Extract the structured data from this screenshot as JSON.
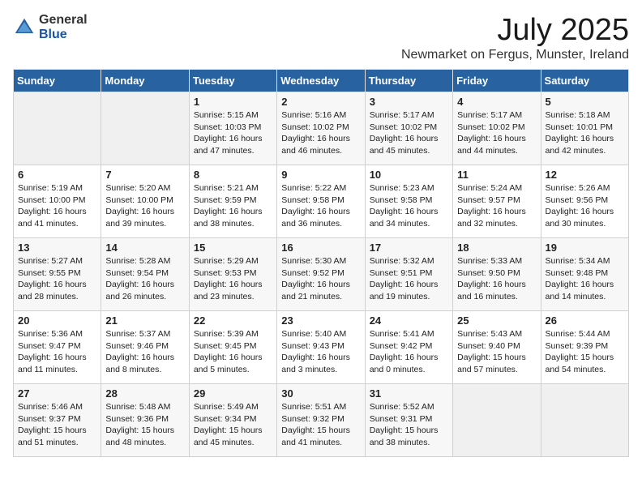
{
  "logo": {
    "general": "General",
    "blue": "Blue"
  },
  "title": "July 2025",
  "location": "Newmarket on Fergus, Munster, Ireland",
  "days_of_week": [
    "Sunday",
    "Monday",
    "Tuesday",
    "Wednesday",
    "Thursday",
    "Friday",
    "Saturday"
  ],
  "weeks": [
    [
      {
        "day": "",
        "content": ""
      },
      {
        "day": "",
        "content": ""
      },
      {
        "day": "1",
        "content": "Sunrise: 5:15 AM\nSunset: 10:03 PM\nDaylight: 16 hours\nand 47 minutes."
      },
      {
        "day": "2",
        "content": "Sunrise: 5:16 AM\nSunset: 10:02 PM\nDaylight: 16 hours\nand 46 minutes."
      },
      {
        "day": "3",
        "content": "Sunrise: 5:17 AM\nSunset: 10:02 PM\nDaylight: 16 hours\nand 45 minutes."
      },
      {
        "day": "4",
        "content": "Sunrise: 5:17 AM\nSunset: 10:02 PM\nDaylight: 16 hours\nand 44 minutes."
      },
      {
        "day": "5",
        "content": "Sunrise: 5:18 AM\nSunset: 10:01 PM\nDaylight: 16 hours\nand 42 minutes."
      }
    ],
    [
      {
        "day": "6",
        "content": "Sunrise: 5:19 AM\nSunset: 10:00 PM\nDaylight: 16 hours\nand 41 minutes."
      },
      {
        "day": "7",
        "content": "Sunrise: 5:20 AM\nSunset: 10:00 PM\nDaylight: 16 hours\nand 39 minutes."
      },
      {
        "day": "8",
        "content": "Sunrise: 5:21 AM\nSunset: 9:59 PM\nDaylight: 16 hours\nand 38 minutes."
      },
      {
        "day": "9",
        "content": "Sunrise: 5:22 AM\nSunset: 9:58 PM\nDaylight: 16 hours\nand 36 minutes."
      },
      {
        "day": "10",
        "content": "Sunrise: 5:23 AM\nSunset: 9:58 PM\nDaylight: 16 hours\nand 34 minutes."
      },
      {
        "day": "11",
        "content": "Sunrise: 5:24 AM\nSunset: 9:57 PM\nDaylight: 16 hours\nand 32 minutes."
      },
      {
        "day": "12",
        "content": "Sunrise: 5:26 AM\nSunset: 9:56 PM\nDaylight: 16 hours\nand 30 minutes."
      }
    ],
    [
      {
        "day": "13",
        "content": "Sunrise: 5:27 AM\nSunset: 9:55 PM\nDaylight: 16 hours\nand 28 minutes."
      },
      {
        "day": "14",
        "content": "Sunrise: 5:28 AM\nSunset: 9:54 PM\nDaylight: 16 hours\nand 26 minutes."
      },
      {
        "day": "15",
        "content": "Sunrise: 5:29 AM\nSunset: 9:53 PM\nDaylight: 16 hours\nand 23 minutes."
      },
      {
        "day": "16",
        "content": "Sunrise: 5:30 AM\nSunset: 9:52 PM\nDaylight: 16 hours\nand 21 minutes."
      },
      {
        "day": "17",
        "content": "Sunrise: 5:32 AM\nSunset: 9:51 PM\nDaylight: 16 hours\nand 19 minutes."
      },
      {
        "day": "18",
        "content": "Sunrise: 5:33 AM\nSunset: 9:50 PM\nDaylight: 16 hours\nand 16 minutes."
      },
      {
        "day": "19",
        "content": "Sunrise: 5:34 AM\nSunset: 9:48 PM\nDaylight: 16 hours\nand 14 minutes."
      }
    ],
    [
      {
        "day": "20",
        "content": "Sunrise: 5:36 AM\nSunset: 9:47 PM\nDaylight: 16 hours\nand 11 minutes."
      },
      {
        "day": "21",
        "content": "Sunrise: 5:37 AM\nSunset: 9:46 PM\nDaylight: 16 hours\nand 8 minutes."
      },
      {
        "day": "22",
        "content": "Sunrise: 5:39 AM\nSunset: 9:45 PM\nDaylight: 16 hours\nand 5 minutes."
      },
      {
        "day": "23",
        "content": "Sunrise: 5:40 AM\nSunset: 9:43 PM\nDaylight: 16 hours\nand 3 minutes."
      },
      {
        "day": "24",
        "content": "Sunrise: 5:41 AM\nSunset: 9:42 PM\nDaylight: 16 hours\nand 0 minutes."
      },
      {
        "day": "25",
        "content": "Sunrise: 5:43 AM\nSunset: 9:40 PM\nDaylight: 15 hours\nand 57 minutes."
      },
      {
        "day": "26",
        "content": "Sunrise: 5:44 AM\nSunset: 9:39 PM\nDaylight: 15 hours\nand 54 minutes."
      }
    ],
    [
      {
        "day": "27",
        "content": "Sunrise: 5:46 AM\nSunset: 9:37 PM\nDaylight: 15 hours\nand 51 minutes."
      },
      {
        "day": "28",
        "content": "Sunrise: 5:48 AM\nSunset: 9:36 PM\nDaylight: 15 hours\nand 48 minutes."
      },
      {
        "day": "29",
        "content": "Sunrise: 5:49 AM\nSunset: 9:34 PM\nDaylight: 15 hours\nand 45 minutes."
      },
      {
        "day": "30",
        "content": "Sunrise: 5:51 AM\nSunset: 9:32 PM\nDaylight: 15 hours\nand 41 minutes."
      },
      {
        "day": "31",
        "content": "Sunrise: 5:52 AM\nSunset: 9:31 PM\nDaylight: 15 hours\nand 38 minutes."
      },
      {
        "day": "",
        "content": ""
      },
      {
        "day": "",
        "content": ""
      }
    ]
  ]
}
